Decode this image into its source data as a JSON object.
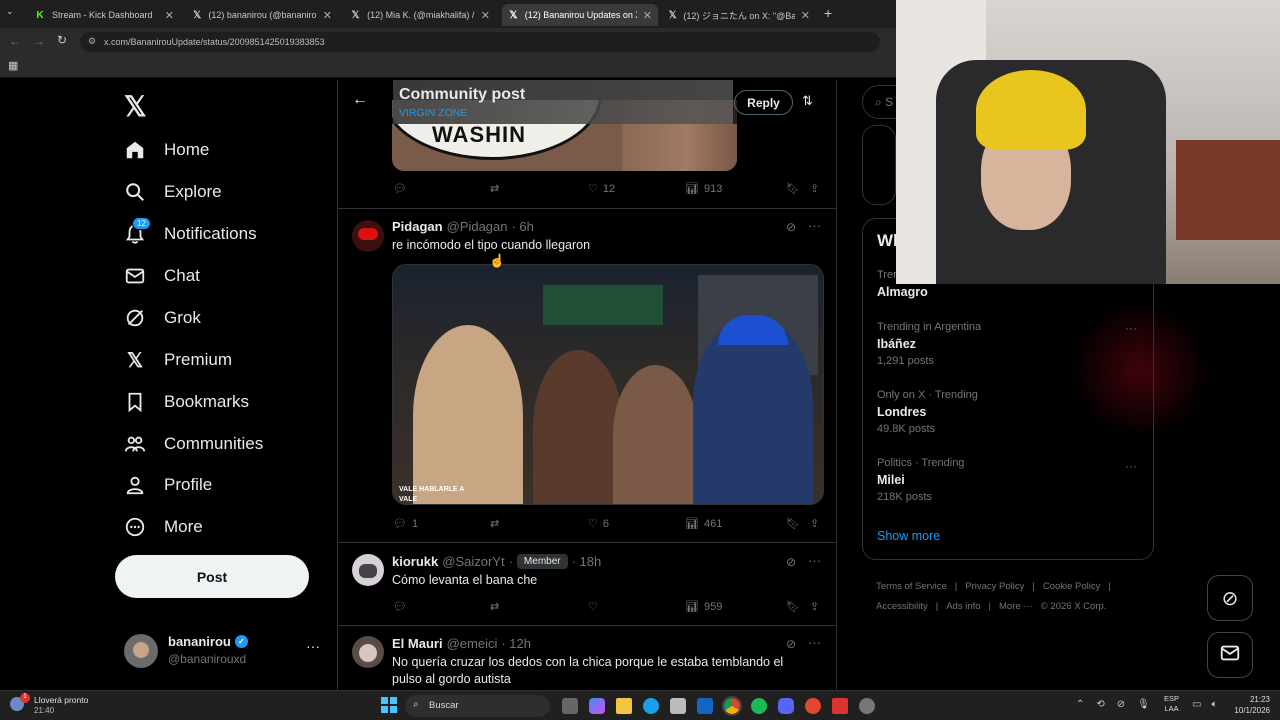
{
  "browser": {
    "tabs": [
      {
        "title": "Stream - Kick Dashboard",
        "icon": "kick-icon"
      },
      {
        "title": "(12) bananirou (@bananirouxd)",
        "icon": "x-logo-icon"
      },
      {
        "title": "(12) Mia K. (@miakhalifa) / X",
        "icon": "x-logo-icon"
      },
      {
        "title": "(12) Bananirou Updates on X: \"",
        "icon": "x-logo-icon"
      },
      {
        "title": "(12) ジョニたん on X: \"@Bananirou",
        "icon": "x-logo-icon"
      }
    ],
    "url": "x.com/BananirouUpdate/status/2009851425019383853"
  },
  "nav": {
    "items": [
      {
        "label": "Home",
        "icon": "home-icon"
      },
      {
        "label": "Explore",
        "icon": "search-icon"
      },
      {
        "label": "Notifications",
        "icon": "bell-icon",
        "badge": "12"
      },
      {
        "label": "Chat",
        "icon": "mail-icon"
      },
      {
        "label": "Grok",
        "icon": "grok-icon"
      },
      {
        "label": "Premium",
        "icon": "x-logo-icon"
      },
      {
        "label": "Bookmarks",
        "icon": "bookmark-icon"
      },
      {
        "label": "Communities",
        "icon": "people-icon"
      },
      {
        "label": "Profile",
        "icon": "person-icon"
      },
      {
        "label": "More",
        "icon": "more-circle-icon"
      }
    ],
    "post_label": "Post",
    "account": {
      "name": "bananirou",
      "handle": "@bananirouxd"
    }
  },
  "header": {
    "title": "Community post",
    "subtitle": "VIRGIN ZONE",
    "reply_label": "Reply",
    "image_caption": "WASHIN"
  },
  "tweets": [
    {
      "counts": {
        "reply": "",
        "retweet": "",
        "like": "12",
        "views": "913"
      }
    },
    {
      "name": "Pidagan",
      "handle": "@Pidagan",
      "time": "· 6h",
      "text": "re incómodo el tipo cuando llegaron",
      "video_caption": "VALE HABLARLE A\nVALE",
      "counts": {
        "reply": "1",
        "retweet": "",
        "like": "6",
        "views": "461"
      }
    },
    {
      "name": "kiorukk",
      "handle": "@SaizorYt",
      "badge": "Member",
      "time": "· 18h",
      "text": "Cómo levanta el bana che",
      "counts": {
        "reply": "",
        "retweet": "",
        "like": "",
        "views": "959"
      }
    },
    {
      "name": "El Mauri",
      "handle": "@emeici",
      "time": "· 12h",
      "text": "No quería cruzar los dedos con la chica porque le estaba temblando el pulso al gordo autista"
    }
  ],
  "right": {
    "search_placeholder": "S",
    "trends_title": "Wh",
    "trends": [
      {
        "context": "Trer",
        "name": "Almagro",
        "posts": ""
      },
      {
        "context": "Trending in Argentina",
        "name": "Ibáñez",
        "posts": "1,291 posts"
      },
      {
        "context": "Only on X · Trending",
        "name": "Londres",
        "posts": "49.8K posts"
      },
      {
        "context": "Politics · Trending",
        "name": "Milei",
        "posts": "218K posts"
      }
    ],
    "show_more": "Show more",
    "footer": [
      "Terms of Service",
      "|",
      "Privacy Policy",
      "|",
      "Cookie Policy",
      "|",
      "Accessibility",
      "|",
      "Ads info",
      "|",
      "More ···",
      "© 2026 X Corp."
    ]
  },
  "taskbar": {
    "weather_title": "Lloverá pronto",
    "weather_time": "21:40",
    "weather_badge": "1",
    "search_label": "Buscar",
    "lang": "ESP",
    "lang2": "LAA",
    "clock_time": "21:23",
    "clock_date": "10/1/2026"
  },
  "colors": {
    "accent": "#1d9bf0",
    "bg": "#000000",
    "border": "#2f3336",
    "muted": "#71767b"
  }
}
